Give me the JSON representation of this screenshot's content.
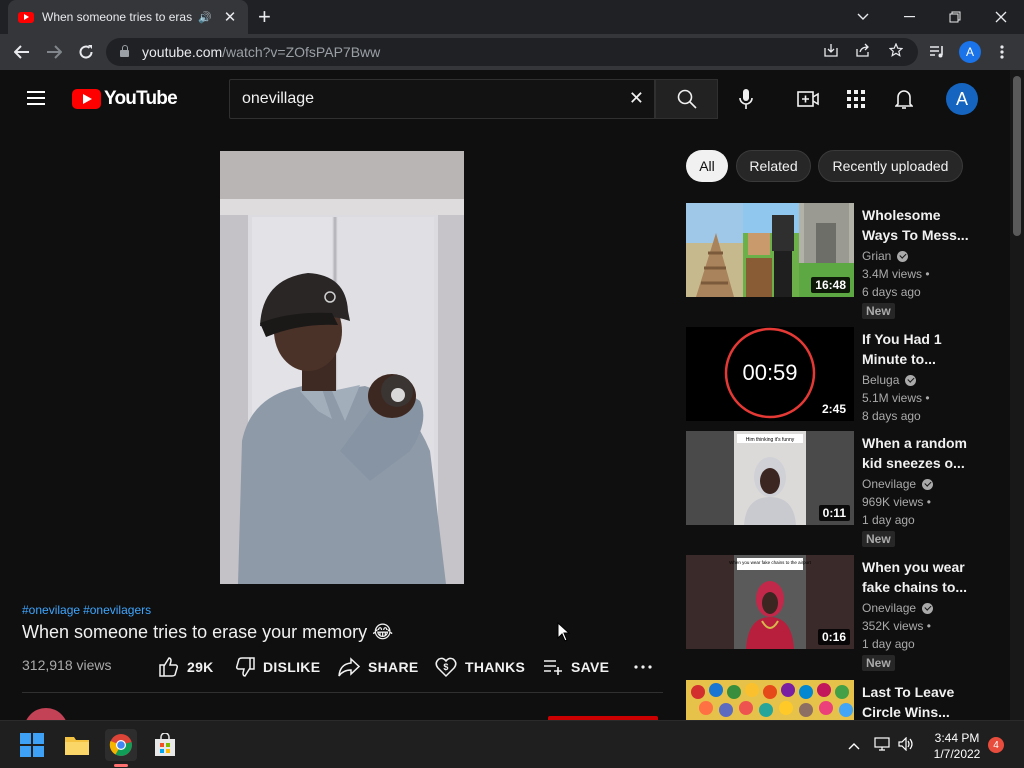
{
  "browser": {
    "tab_title": "When someone tries to erase your memory",
    "url_host": "youtube.com",
    "url_path": "/watch?v=ZOfsPAP7Bww",
    "profile_initial": "A"
  },
  "header": {
    "logo_text": "YouTube",
    "search_value": "onevillage",
    "avatar_initial": "A"
  },
  "video": {
    "hashtags": [
      "#onevilage",
      "#onevilagers"
    ],
    "title": "When someone tries to erase your memory 😂",
    "views": "312,918 views",
    "like_count": "29K",
    "dislike_label": "DISLIKE",
    "share_label": "SHARE",
    "thanks_label": "THANKS",
    "save_label": "SAVE"
  },
  "chips": [
    "All",
    "Related",
    "Recently uploaded"
  ],
  "related": [
    {
      "title": "Wholesome Ways To Mess...",
      "channel": "Grian",
      "views": "3.4M views •",
      "age": "6 days ago",
      "badge": "New",
      "duration": "16:48"
    },
    {
      "title": "If You Had 1 Minute to...",
      "channel": "Beluga",
      "views": "5.1M views •",
      "age": "8 days ago",
      "badge": "",
      "duration": "2:45",
      "timer_text": "00:59"
    },
    {
      "title": "When a random kid sneezes o...",
      "channel": "Onevilage",
      "views": "969K views •",
      "age": "1 day ago",
      "badge": "New",
      "duration": "0:11",
      "thumb_caption": "Him thinking it's funny"
    },
    {
      "title": "When you wear fake chains to...",
      "channel": "Onevilage",
      "views": "352K views •",
      "age": "1 day ago",
      "badge": "New",
      "duration": "0:16",
      "thumb_caption": "When you wear fake chains to the airport"
    },
    {
      "title": "Last To Leave Circle Wins...",
      "channel": "",
      "views": "",
      "age": "",
      "badge": "",
      "duration": ""
    }
  ],
  "taskbar": {
    "time": "3:44 PM",
    "date": "1/7/2022",
    "notifications": "4"
  },
  "colors": {
    "background": "#0f0f0f",
    "youtube_red": "#ff0000",
    "link_blue": "#3ea6ff",
    "chrome_dark": "#202124",
    "avatar_blue": "#1565c0"
  }
}
